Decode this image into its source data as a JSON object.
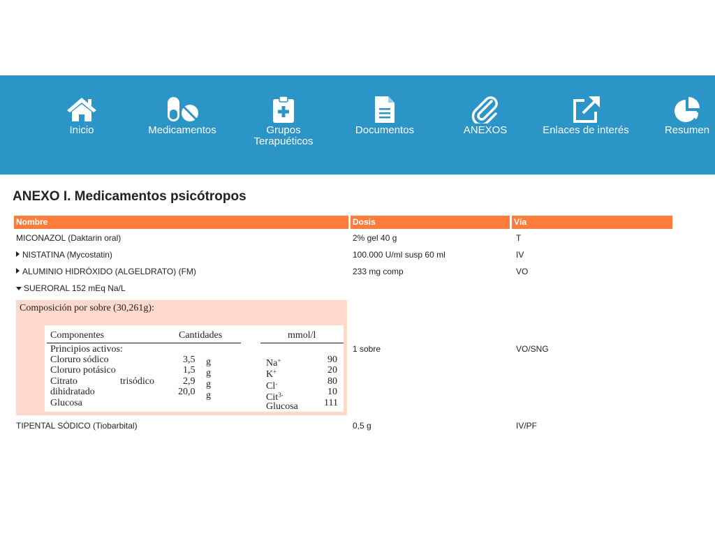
{
  "nav": {
    "items": [
      {
        "label": "Inicio",
        "icon": "home-icon"
      },
      {
        "label": "Medicamentos",
        "icon": "pills-icon"
      },
      {
        "label": "Grupos Terapuéticos",
        "icon": "medical-clipboard-icon"
      },
      {
        "label": "Documentos",
        "icon": "document-icon"
      },
      {
        "label": "ANEXOS",
        "icon": "paperclip-icon"
      },
      {
        "label": "Enlaces de interés",
        "icon": "external-link-icon"
      },
      {
        "label": "Resumen",
        "icon": "pie-chart-icon"
      }
    ]
  },
  "page": {
    "title": "ANEXO I. Medicamentos psicótropos"
  },
  "table": {
    "headers": [
      "Nombre",
      "Dosis",
      "Vía"
    ],
    "rows": [
      {
        "name": "MICONAZOL (Daktarin oral)",
        "dose": "2% gel 40 g",
        "route": "T",
        "toggle": "none"
      },
      {
        "name": "NISTATINA (Mycostatin)",
        "dose": "100.000 U/ml susp 60 ml",
        "route": "IV",
        "toggle": "collapsed"
      },
      {
        "name": "ALUMINIO HIDRÓXIDO (ALGELDRATO) (FM)",
        "dose": "233 mg comp",
        "route": "VO",
        "toggle": "collapsed"
      },
      {
        "name": "SUERORAL 152 mEq Na/L",
        "dose": "1 sobre",
        "route": "VO/SNG",
        "toggle": "expanded"
      },
      {
        "name": "TIPENTAL SÓDICO (Tiobarbital)",
        "dose": "0,5 g",
        "route": "IV/PF",
        "toggle": "none"
      }
    ]
  },
  "composition": {
    "title": "Composición por sobre (30,261g):",
    "headers": {
      "components": "Componentes",
      "amounts": "Cantidades",
      "mmol": "mmol/l"
    },
    "section_label": "Principios activos:",
    "components": [
      {
        "name": "Cloruro sódico",
        "amount": "3,5",
        "unit": "g"
      },
      {
        "name": "Cloruro potásico",
        "amount": "1,5",
        "unit": "g"
      },
      {
        "name": "Citrato",
        "name_extra": "trisódico",
        "amount": "2,9",
        "unit": "g"
      },
      {
        "name": "dihidratado",
        "amount": "20,0",
        "unit": "g"
      },
      {
        "name": "Glucosa"
      }
    ],
    "ions": [
      {
        "symbol": "Na",
        "charge": "+",
        "value": "90"
      },
      {
        "symbol": "K",
        "charge": "+",
        "value": "20"
      },
      {
        "symbol": "Cl",
        "charge": "-",
        "value": "80"
      },
      {
        "symbol": "Cit",
        "charge": "3-",
        "value": "10"
      },
      {
        "symbol": "Glucosa",
        "charge": "",
        "value": "111"
      }
    ]
  }
}
